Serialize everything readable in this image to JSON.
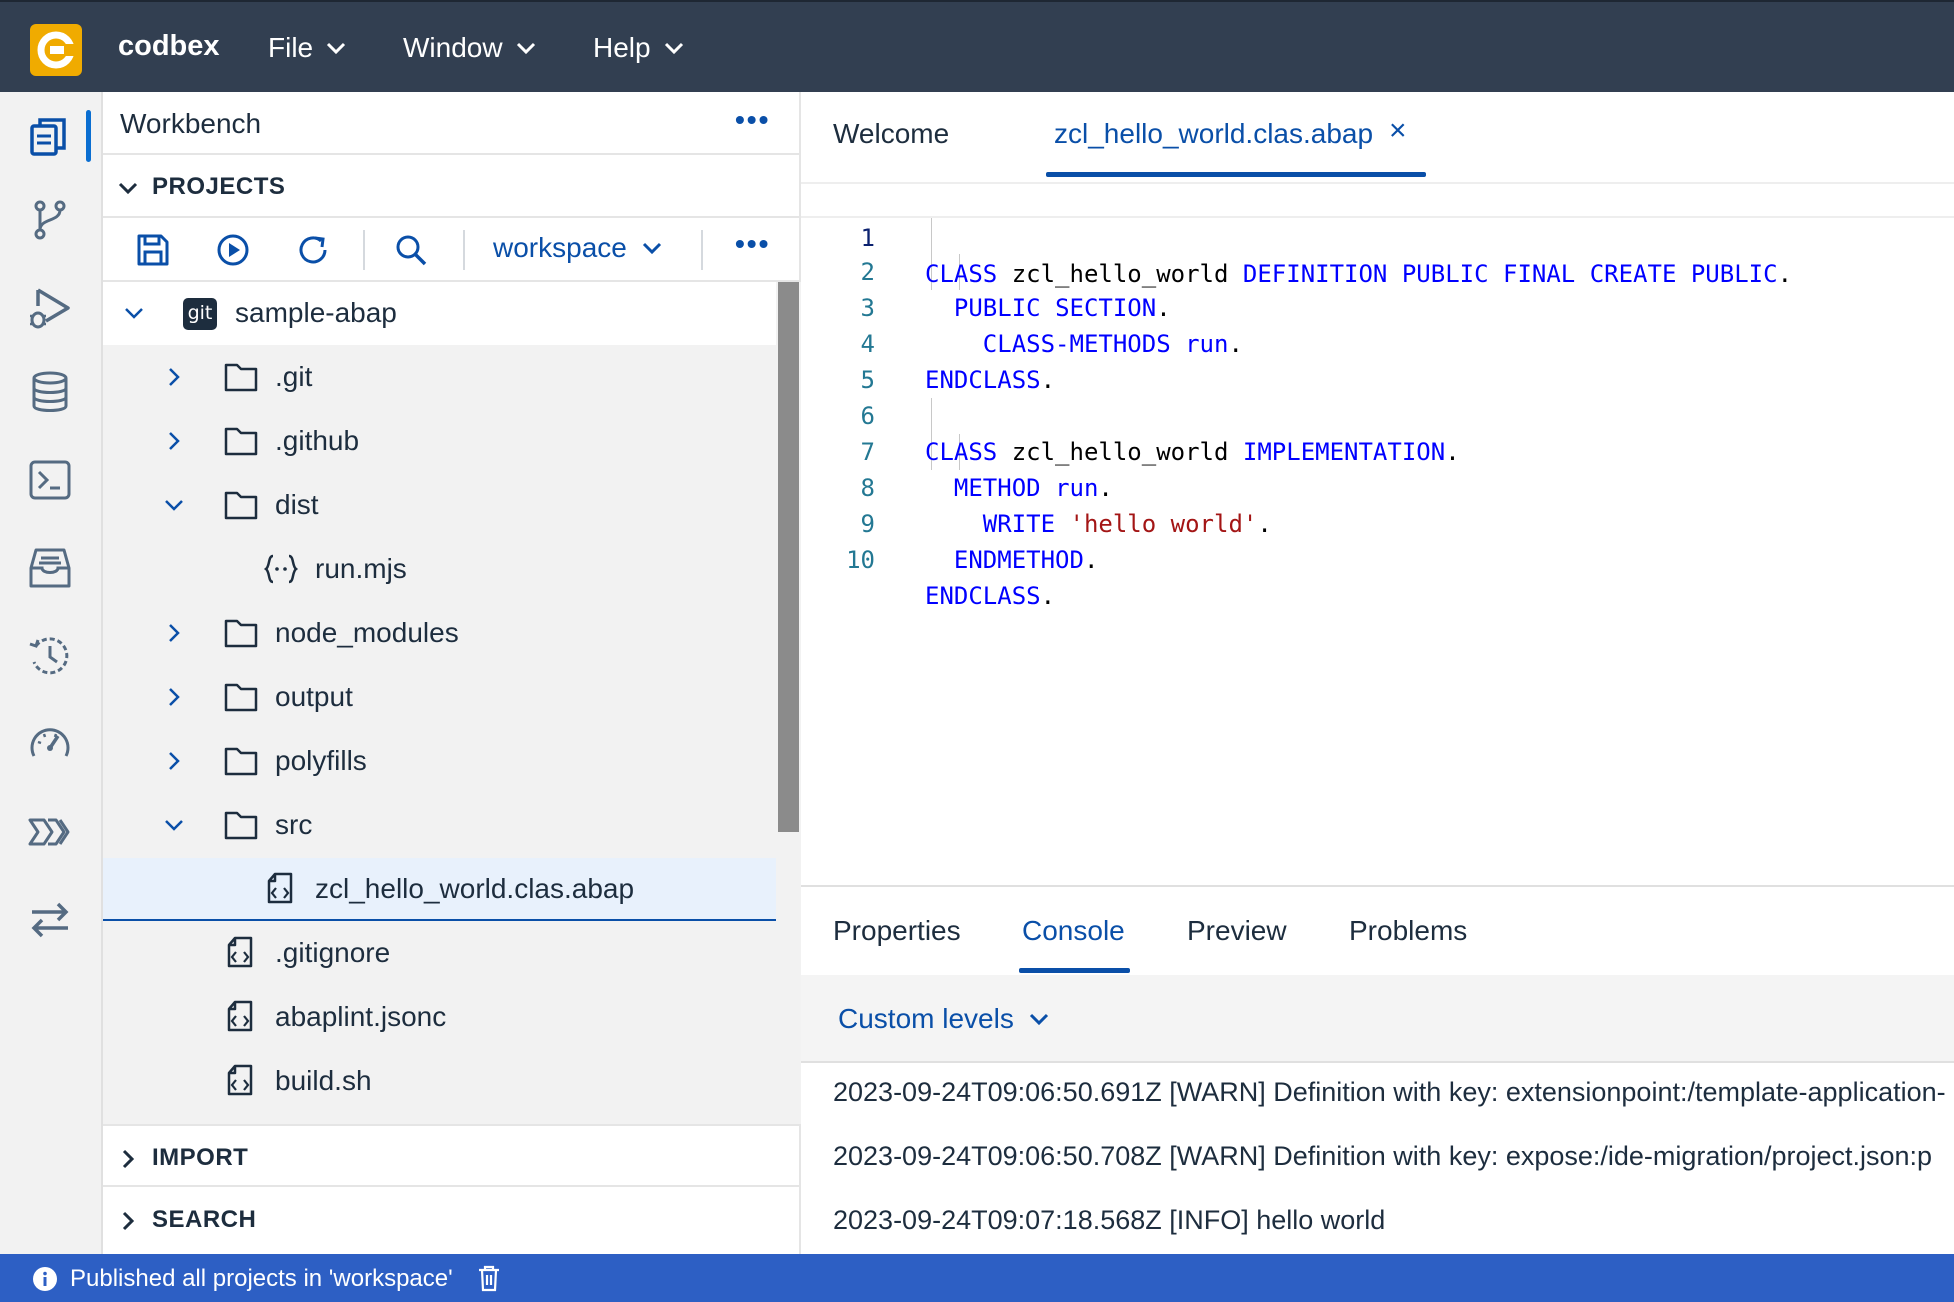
{
  "app": {
    "name": "codbex",
    "menus": [
      "File",
      "Window",
      "Help"
    ]
  },
  "activity_bar": {
    "icons": [
      "projects-icon",
      "git-branch-icon",
      "debug-icon",
      "database-icon",
      "terminal-icon",
      "inbox-icon",
      "history-icon",
      "dashboard-icon",
      "pipelines-icon",
      "transfer-icon"
    ],
    "active": "projects-icon"
  },
  "workbench": {
    "title": "Workbench",
    "more": "•••",
    "projects_section": "PROJECTS",
    "workspace_select": "workspace",
    "import_section": "IMPORT",
    "search_section": "SEARCH",
    "tree": [
      {
        "label": "sample-abap",
        "type": "git-repo",
        "expanded": true
      },
      {
        "label": ".git",
        "type": "folder",
        "expanded": false
      },
      {
        "label": ".github",
        "type": "folder",
        "expanded": false
      },
      {
        "label": "dist",
        "type": "folder",
        "expanded": true
      },
      {
        "label": "run.mjs",
        "type": "js-file"
      },
      {
        "label": "node_modules",
        "type": "folder",
        "expanded": false
      },
      {
        "label": "output",
        "type": "folder",
        "expanded": false
      },
      {
        "label": "polyfills",
        "type": "folder",
        "expanded": false
      },
      {
        "label": "src",
        "type": "folder",
        "expanded": true
      },
      {
        "label": "zcl_hello_world.clas.abap",
        "type": "code-file",
        "selected": true
      },
      {
        "label": ".gitignore",
        "type": "code-file"
      },
      {
        "label": "abaplint.jsonc",
        "type": "code-file"
      },
      {
        "label": "build.sh",
        "type": "code-file"
      }
    ]
  },
  "editor": {
    "tabs": [
      {
        "label": "Welcome",
        "active": false
      },
      {
        "label": "zcl_hello_world.clas.abap",
        "active": true,
        "close": "×"
      }
    ],
    "line_numbers": [
      "1",
      "2",
      "3",
      "4",
      "5",
      "6",
      "7",
      "8",
      "9",
      "10"
    ],
    "current_line": "1"
  },
  "bottom_panel": {
    "tabs": [
      "Properties",
      "Console",
      "Preview",
      "Problems"
    ],
    "active_tab": "Console",
    "log_level": "Custom levels",
    "logs": [
      "2023-09-24T09:06:50.691Z [WARN] Definition with key: extensionpoint:/template-application-",
      "2023-09-24T09:06:50.708Z [WARN] Definition with key: expose:/ide-migration/project.json:p",
      "2023-09-24T09:07:18.568Z [INFO] hello world"
    ]
  },
  "status_bar": {
    "message": "Published all projects in 'workspace'"
  },
  "colors": {
    "topbar": "#323f51",
    "accent": "#0a4fa8",
    "statusbar": "#2d5fc4",
    "logo": "#f0ab00",
    "keyword": "#0000ff",
    "string": "#a31515"
  }
}
